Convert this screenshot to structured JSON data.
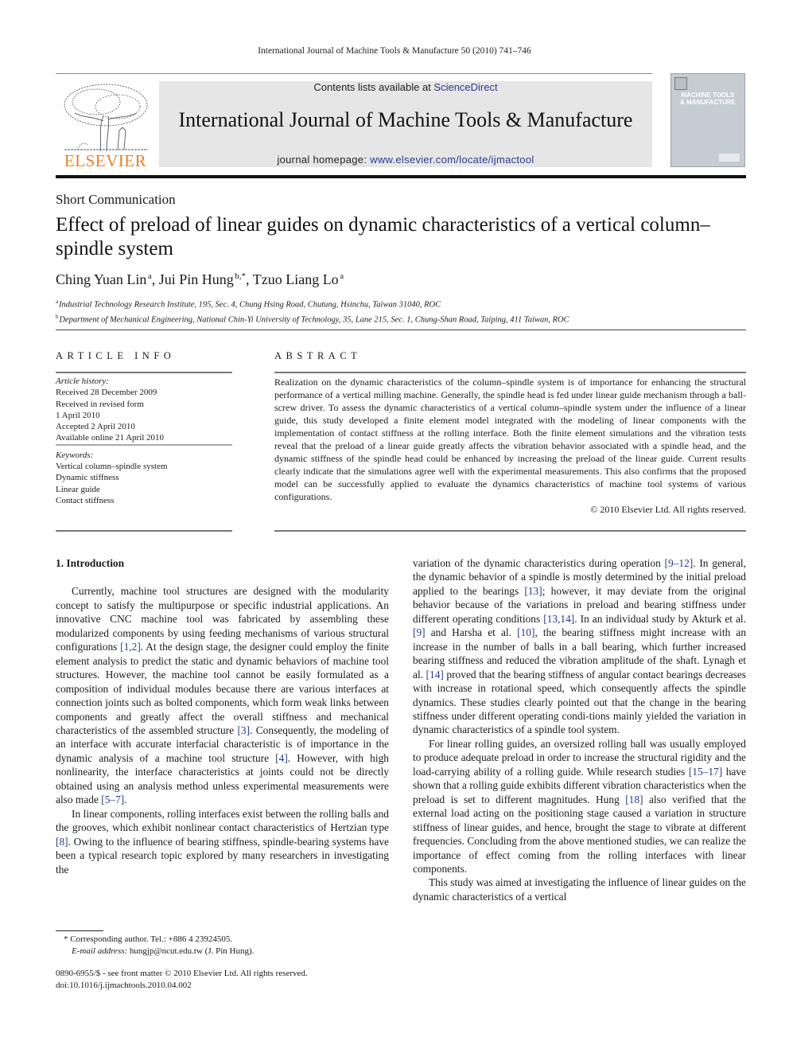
{
  "running_head": "International Journal of Machine Tools & Manufacture 50 (2010) 741–746",
  "masthead": {
    "publisher_logo_text": "ELSEVIER",
    "contents_prefix": "Contents lists available at ",
    "contents_link": "ScienceDirect",
    "journal_title": "International Journal of Machine Tools & Manufacture",
    "homepage_prefix": "journal homepage: ",
    "homepage_link": "www.elsevier.com/locate/ijmactool",
    "cover_title_line1": "MACHINE TOOLS",
    "cover_title_line2": "& MANUFACTURE",
    "brand_color": "#f07f1a",
    "link_color": "#2b3a8c"
  },
  "article": {
    "section_type": "Short Communication",
    "title": "Effect of preload of linear guides on dynamic characteristics of a vertical column–spindle system",
    "authors": [
      {
        "name": "Ching Yuan Lin",
        "sup": "a"
      },
      {
        "name": "Jui Pin Hung",
        "sup": "b,*"
      },
      {
        "name": "Tzuo Liang Lo",
        "sup": "a"
      }
    ],
    "affiliations": [
      {
        "key": "a",
        "text": "Industrial Technology Research Institute, 195, Sec. 4, Chung Hsing Road, Chutung, Hsinchu, Taiwan 31040, ROC"
      },
      {
        "key": "b",
        "text": "Department of Mechanical Engineering, National Chin-Yi University of Technology, 35, Lane 215, Sec. 1, Chung-Shan Road, Taiping, 411 Taiwan, ROC"
      }
    ]
  },
  "article_info": {
    "heading": "ARTICLE INFO",
    "history_label": "Article history:",
    "history": [
      "Received 28 December 2009",
      "Received in revised form",
      "1 April 2010",
      "Accepted 2 April 2010",
      "Available online 21 April 2010"
    ],
    "keywords_label": "Keywords:",
    "keywords": [
      "Vertical column–spindle system",
      "Dynamic stiffness",
      "Linear guide",
      "Contact stiffness"
    ]
  },
  "abstract": {
    "heading": "ABSTRACT",
    "text": "Realization on the dynamic characteristics of the column–spindle system is of importance for enhancing the structural performance of a vertical milling machine. Generally, the spindle head is fed under linear guide mechanism through a ball-screw driver. To assess the dynamic characteristics of a vertical column–spindle system under the influence of a linear guide, this study developed a finite element model integrated with the modeling of linear components with the implementation of contact stiffness at the rolling interface. Both the finite element simulations and the vibration tests reveal that the preload of a linear guide greatly affects the vibration behavior associated with a spindle head, and the dynamic stiffness of the spindle head could be enhanced by increasing the preload of the linear guide. Current results clearly indicate that the simulations agree well with the experimental measurements. This also confirms that the proposed model can be successfully applied to evaluate the dynamics characteristics of machine tool systems of various configurations.",
    "copyright": "© 2010 Elsevier Ltd. All rights reserved."
  },
  "body": {
    "section_heading": "1.  Introduction",
    "left_paragraphs": [
      [
        {
          "t": "Currently, machine tool structures are designed with the modularity concept to satisfy the multipurpose or specific industrial applications. An innovative CNC machine tool was fabricated by assembling these modularized components by using feeding mechanisms of various structural configurations "
        },
        {
          "ref": "[1,2]"
        },
        {
          "t": ". At the design stage, the designer could employ the finite element analysis to predict the static and dynamic behaviors of machine tool structures. However, the machine tool cannot be easily formulated as a composition of individual modules because there are various interfaces at connection joints such as bolted components, which form weak links between components and greatly affect the overall stiffness and mechanical characteristics of the assembled structure "
        },
        {
          "ref": "[3]"
        },
        {
          "t": ". Consequently, the modeling of an interface with accurate interfacial characteristic is of importance in the dynamic analysis of a machine tool structure "
        },
        {
          "ref": "[4]"
        },
        {
          "t": ". However, with high nonlinearity, the interface characteristics at joints could not be directly obtained using an analysis method unless experimental measurements were also made "
        },
        {
          "ref": "[5–7]"
        },
        {
          "t": "."
        }
      ],
      [
        {
          "t": "In linear components, rolling interfaces exist between the rolling balls and the grooves, which exhibit nonlinear contact characteristics of Hertzian type "
        },
        {
          "ref": "[8]"
        },
        {
          "t": ". Owing to the influence of bearing stiffness, spindle-bearing systems have been a typical research topic explored by many researchers in investigating the"
        }
      ]
    ],
    "right_paragraphs": [
      [
        {
          "t": "variation of the dynamic characteristics during operation "
        },
        {
          "ref": "[9–12]"
        },
        {
          "t": ". In general, the dynamic behavior of a spindle is mostly determined by the initial preload applied to the bearings "
        },
        {
          "ref": "[13]"
        },
        {
          "t": "; however, it may deviate from the original behavior because of the variations in preload and bearing stiffness under different operating conditions "
        },
        {
          "ref": "[13,14]"
        },
        {
          "t": ". In an individual study by Akturk et al. "
        },
        {
          "ref": "[9]"
        },
        {
          "t": " and Harsha et al. "
        },
        {
          "ref": "[10]"
        },
        {
          "t": ", the bearing stiffness might increase with an increase in the number of balls in a ball bearing, which further increased bearing stiffness and reduced the vibration amplitude of the shaft. Lynagh et al. "
        },
        {
          "ref": "[14]"
        },
        {
          "t": " proved that the bearing stiffness of angular contact bearings decreases with increase in rotational speed, which consequently affects the spindle dynamics. These studies clearly pointed out that the change in the bearing stiffness under different operating condi-tions mainly yielded the variation in dynamic characteristics of a spindle tool system."
        }
      ],
      [
        {
          "t": "For linear rolling guides, an oversized rolling ball was usually employed to produce adequate preload in order to increase the structural rigidity and the load-carrying ability of a rolling guide. While research studies "
        },
        {
          "ref": "[15–17]"
        },
        {
          "t": " have shown that a rolling guide exhibits different vibration characteristics when the preload is set to different magnitudes. Hung "
        },
        {
          "ref": "[18]"
        },
        {
          "t": " also verified that the external load acting on the positioning stage caused a variation in structure stiffness of linear guides, and hence, brought the stage to vibrate at different frequencies. Concluding from the above mentioned studies, we can realize the importance of effect coming from the rolling interfaces with linear components."
        }
      ],
      [
        {
          "t": "This study was aimed at investigating the influence of linear guides on the dynamic characteristics of a vertical"
        }
      ]
    ]
  },
  "footnotes": {
    "corresponding": "* Corresponding author. Tel.: +886 4 23924505.",
    "email_label": "E-mail address:",
    "email": " hungjp@ncut.edu.tw (J. Pin Hung).",
    "front_matter": "0890-6955/$ - see front matter © 2010 Elsevier Ltd. All rights reserved.",
    "doi": "doi:10.1016/j.ijmachtools.2010.04.002"
  }
}
